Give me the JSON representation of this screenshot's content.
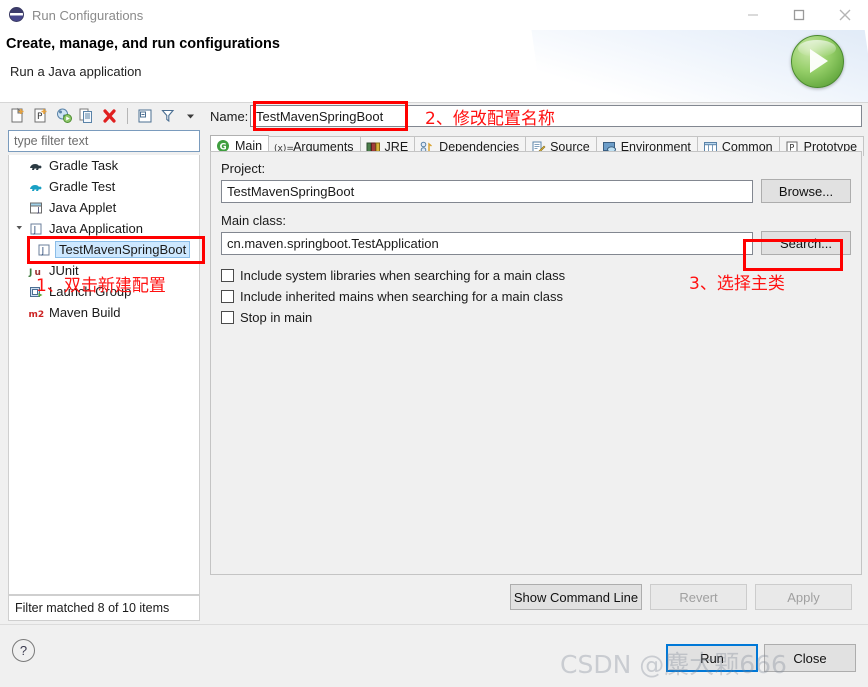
{
  "window": {
    "title": "Run Configurations",
    "icon": "eclipse-icon",
    "controls": {
      "minimize": "minimize-icon",
      "maximize": "maximize-icon",
      "close": "close-icon"
    }
  },
  "banner": {
    "title": "Create, manage, and run configurations",
    "subtitle": "Run a Java application",
    "badge_icon": "run-play-icon"
  },
  "left": {
    "toolbar": [
      {
        "name": "new-configuration-icon",
        "tooltip": "New launch configuration"
      },
      {
        "name": "new-prototype-icon",
        "tooltip": "New prototype"
      },
      {
        "name": "export-configuration-icon",
        "tooltip": "Export"
      },
      {
        "name": "duplicate-configuration-icon",
        "tooltip": "Duplicate"
      },
      {
        "name": "delete-configuration-icon",
        "tooltip": "Delete"
      },
      {
        "name": "collapse-all-icon",
        "tooltip": "Collapse All"
      },
      {
        "name": "filter-icon",
        "tooltip": "Filter launch configurations"
      },
      {
        "name": "view-menu-icon",
        "tooltip": "View Menu"
      }
    ],
    "filter_placeholder": "type filter text",
    "filter_value": "",
    "tree": [
      {
        "label": "Gradle Task",
        "icon": "gradle-icon",
        "level": 0,
        "expandable": false,
        "selected": false
      },
      {
        "label": "Gradle Test",
        "icon": "gradle-icon",
        "level": 0,
        "expandable": false,
        "selected": false
      },
      {
        "label": "Java Applet",
        "icon": "java-applet-icon",
        "level": 0,
        "expandable": false,
        "selected": false
      },
      {
        "label": "Java Application",
        "icon": "java-application-icon",
        "level": 0,
        "expandable": true,
        "expanded": true,
        "selected": false
      },
      {
        "label": "TestMavenSpringBoot",
        "icon": "java-application-icon",
        "level": 1,
        "expandable": false,
        "selected": true
      },
      {
        "label": "JUnit",
        "icon": "junit-icon",
        "level": 0,
        "expandable": false,
        "selected": false
      },
      {
        "label": "Launch Group",
        "icon": "launch-group-icon",
        "level": 0,
        "expandable": false,
        "selected": false
      },
      {
        "label": "Maven Build",
        "icon": "maven-icon",
        "level": 0,
        "expandable": false,
        "selected": false
      }
    ],
    "status": "Filter matched 8 of 10 items"
  },
  "right": {
    "name_label": "Name:",
    "name_value": "TestMavenSpringBoot",
    "tabs": [
      {
        "label": "Main",
        "icon": "main-tab-icon",
        "active": true
      },
      {
        "label": "Arguments",
        "icon": "arguments-tab-icon",
        "active": false
      },
      {
        "label": "JRE",
        "icon": "jre-tab-icon",
        "active": false
      },
      {
        "label": "Dependencies",
        "icon": "dependencies-tab-icon",
        "active": false
      },
      {
        "label": "Source",
        "icon": "source-tab-icon",
        "active": false
      },
      {
        "label": "Environment",
        "icon": "environment-tab-icon",
        "active": false
      },
      {
        "label": "Common",
        "icon": "common-tab-icon",
        "active": false
      },
      {
        "label": "Prototype",
        "icon": "prototype-tab-icon",
        "active": false
      }
    ],
    "project_group_label": "Project:",
    "project_value": "TestMavenSpringBoot",
    "browse_button": "Browse...",
    "mainclass_group_label": "Main class:",
    "mainclass_value": "cn.maven.springboot.TestApplication",
    "search_button": "Search...",
    "checkboxes": [
      {
        "label": "Include system libraries when searching for a main class",
        "checked": false
      },
      {
        "label": "Include inherited mains when searching for a main class",
        "checked": false
      },
      {
        "label": "Stop in main",
        "checked": false
      }
    ],
    "show_command_line_button": "Show Command Line",
    "revert_button": "Revert",
    "revert_disabled": true,
    "apply_button": "Apply",
    "apply_disabled": true
  },
  "dialog": {
    "help_icon": "help-icon",
    "run_button": "Run",
    "close_button": "Close"
  },
  "annotations": [
    {
      "name": "annotation-step-1",
      "text": "1、双击新建配置"
    },
    {
      "name": "annotation-step-2",
      "text": "2、修改配置名称"
    },
    {
      "name": "annotation-step-3",
      "text": "3、选择主类"
    }
  ],
  "watermark": "CSDN @麋大颗666",
  "colors": {
    "annotation_red": "#ff1111",
    "highlight_box_red": "#ff0000",
    "selection_blue": "#cde8ff",
    "default_button_border": "#0078d7",
    "run_badge_green": "#6eb047"
  }
}
